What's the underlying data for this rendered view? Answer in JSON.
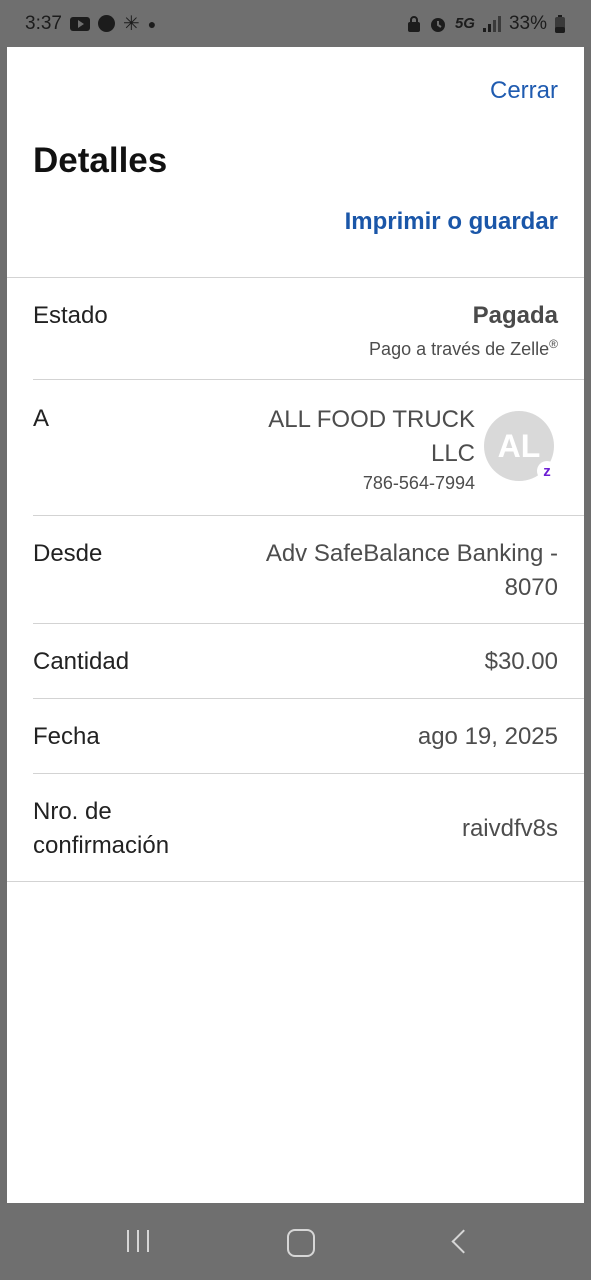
{
  "status_bar": {
    "time": "3:37",
    "network": "5G",
    "battery": "33%",
    "icons": [
      "youtube-icon",
      "spotify-icon",
      "walmart-icon",
      "dot-icon",
      "lock-icon",
      "alarm-icon",
      "signal-icon",
      "battery-icon"
    ]
  },
  "header": {
    "close_label": "Cerrar",
    "title": "Detalles",
    "print_label": "Imprimir o guardar"
  },
  "details": {
    "status": {
      "label": "Estado",
      "value": "Pagada",
      "note": "Pago a través de Zelle",
      "note_mark": "®"
    },
    "recipient": {
      "label": "A",
      "name": "ALL FOOD TRUCK LLC",
      "phone": "786-564-7994",
      "initials": "AL",
      "badge": "z"
    },
    "from": {
      "label": "Desde",
      "value": "Adv SafeBalance Banking - 8070"
    },
    "amount": {
      "label": "Cantidad",
      "value": "$30.00"
    },
    "date": {
      "label": "Fecha",
      "value": "ago 19, 2025"
    },
    "confirmation": {
      "label": "Nro. de confirmación",
      "value": "raivdfv8s"
    }
  },
  "colors": {
    "link": "#1f5bb0",
    "zelle_purple": "#6d1ed4",
    "system_bar": "#6f6f6f"
  }
}
